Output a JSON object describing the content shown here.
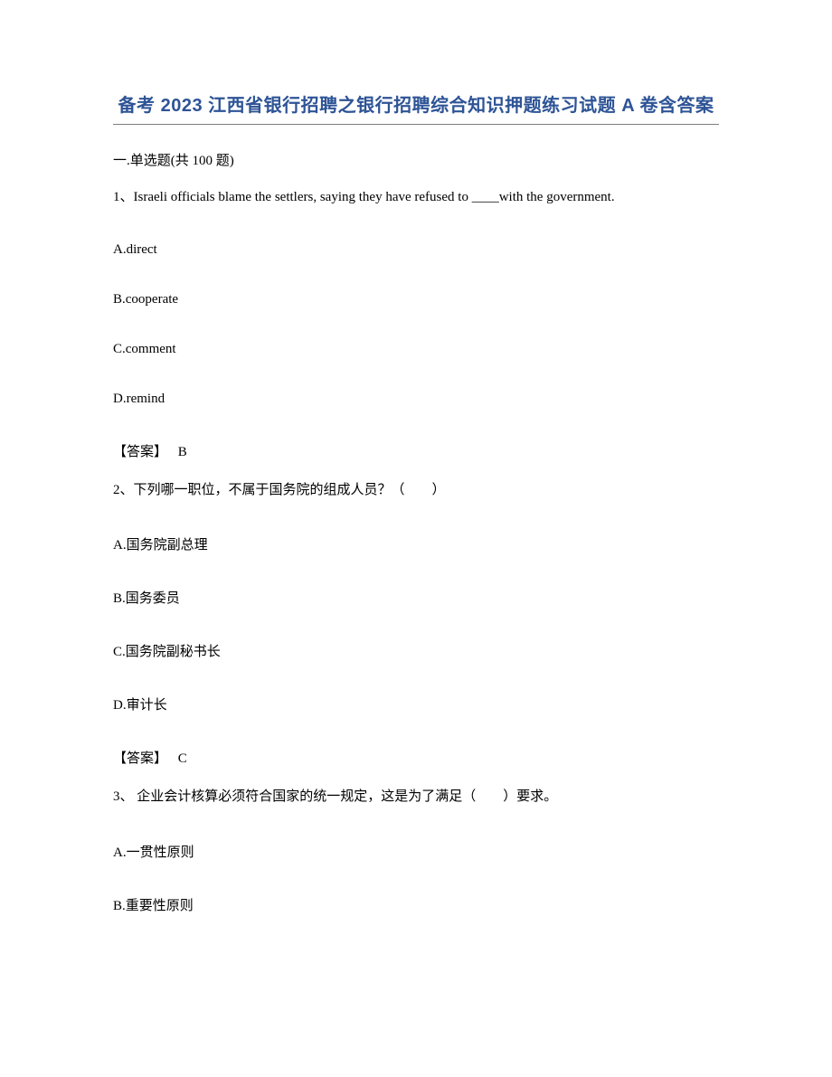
{
  "title": "备考 2023 江西省银行招聘之银行招聘综合知识押题练习试题 A 卷含答案",
  "section_header": "一.单选题(共 100 题)",
  "questions": [
    {
      "number": "1、",
      "text": "Israeli officials blame the settlers, saying they have refused to ____with the government.",
      "options": {
        "A": "A.direct",
        "B": "B.cooperate",
        "C": "C.comment",
        "D": "D.remind"
      },
      "answer_label": "【答案】",
      "answer_value": "B"
    },
    {
      "number": "2、",
      "text": "下列哪一职位，不属于国务院的组成人员？（　　）",
      "options": {
        "A": "A.国务院副总理",
        "B": "B.国务委员",
        "C": "C.国务院副秘书长",
        "D": "D.审计长"
      },
      "answer_label": "【答案】",
      "answer_value": "C"
    },
    {
      "number": "3、",
      "text": " 企业会计核算必须符合国家的统一规定，这是为了满足（　　）要求。",
      "options": {
        "A": "A.一贯性原则",
        "B": "B.重要性原则"
      }
    }
  ]
}
